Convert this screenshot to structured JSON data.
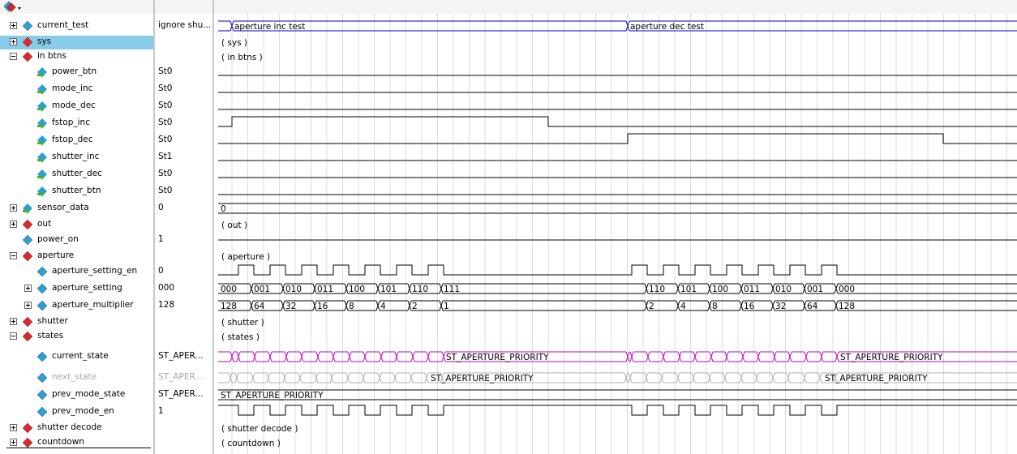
{
  "toolbar": {
    "icon": "signal-dropdown-icon"
  },
  "colors": {
    "group": "#e0262b",
    "signal": "#2a9fd8",
    "input": "#4caf32",
    "state_wave": "#c000c0",
    "bus_top": "#0000d0",
    "selection": "#87cce9",
    "grid": "#dcdcdc"
  },
  "signals": [
    {
      "name": "current_test",
      "value": "ignore shu...",
      "icon": "signal-diamond-icon",
      "expand": "plus"
    },
    {
      "name": "sys",
      "value": "",
      "icon": "group-diamond-icon",
      "expand": "plus",
      "selected": true
    },
    {
      "name": "in btns",
      "value": "",
      "icon": "group-diamond-icon",
      "expand": "minus"
    },
    {
      "name": "power_btn",
      "value": "St0",
      "icon": "input-arrow-icon"
    },
    {
      "name": "mode_inc",
      "value": "St0",
      "icon": "input-arrow-icon"
    },
    {
      "name": "mode_dec",
      "value": "St0",
      "icon": "input-arrow-icon"
    },
    {
      "name": "fstop_inc",
      "value": "St0",
      "icon": "input-arrow-icon"
    },
    {
      "name": "fstop_dec",
      "value": "St0",
      "icon": "input-arrow-icon"
    },
    {
      "name": "shutter_inc",
      "value": "St1",
      "icon": "input-arrow-icon"
    },
    {
      "name": "shutter_dec",
      "value": "St0",
      "icon": "input-arrow-icon"
    },
    {
      "name": "shutter_btn",
      "value": "St0",
      "icon": "input-arrow-icon"
    },
    {
      "name": "sensor_data",
      "value": "0",
      "icon": "input-arrow-icon",
      "expand": "plus"
    },
    {
      "name": "out",
      "value": "",
      "icon": "group-diamond-icon",
      "expand": "plus"
    },
    {
      "name": "power_on",
      "value": "1",
      "icon": "signal-diamond-icon"
    },
    {
      "name": "aperture",
      "value": "",
      "icon": "group-diamond-icon",
      "expand": "minus"
    },
    {
      "name": "aperture_setting_en",
      "value": "0",
      "icon": "signal-diamond-icon"
    },
    {
      "name": "aperture_setting",
      "value": "000",
      "icon": "signal-diamond-icon",
      "expand": "plus"
    },
    {
      "name": "aperture_multiplier",
      "value": "128",
      "icon": "signal-diamond-icon",
      "expand": "plus"
    },
    {
      "name": "shutter",
      "value": "",
      "icon": "group-diamond-icon",
      "expand": "plus"
    },
    {
      "name": "states",
      "value": "",
      "icon": "group-diamond-icon",
      "expand": "minus"
    },
    {
      "name": "current_state",
      "value": "ST_APER...",
      "icon": "signal-diamond-icon"
    },
    {
      "name": "next_state",
      "value": "ST_APER...",
      "icon": "signal-diamond-icon",
      "disabled": true
    },
    {
      "name": "prev_mode_state",
      "value": "ST_APER...",
      "icon": "signal-diamond-icon"
    },
    {
      "name": "prev_mode_en",
      "value": "1",
      "icon": "signal-diamond-icon"
    },
    {
      "name": "shutter decode",
      "value": "",
      "icon": "group-diamond-icon",
      "expand": "plus"
    },
    {
      "name": "countdown",
      "value": "",
      "icon": "group-diamond-icon",
      "expand": "plus"
    }
  ],
  "wave": {
    "test_labels": [
      "aperture inc test",
      "aperture dec test"
    ],
    "group_labels": {
      "sys": "( sys )",
      "in_btns": "( in btns )",
      "out": "( out )",
      "aperture": "( aperture )",
      "shutter": "( shutter )",
      "states": "( states )",
      "shutter_decode": "( shutter decode )",
      "countdown": "( countdown )"
    },
    "sensor_value": "0",
    "aperture_setting_inc": [
      "000",
      "001",
      "010",
      "011",
      "100",
      "101",
      "110",
      "111"
    ],
    "aperture_setting_dec": [
      "110",
      "101",
      "100",
      "011",
      "010",
      "001",
      "000"
    ],
    "aperture_multiplier_inc": [
      "128",
      "64",
      "32",
      "16",
      "8",
      "4",
      "2",
      "1"
    ],
    "aperture_multiplier_dec": [
      "2",
      "4",
      "8",
      "16",
      "32",
      "64",
      "128"
    ],
    "state_label": "ST_APERTURE_PRIORITY"
  }
}
